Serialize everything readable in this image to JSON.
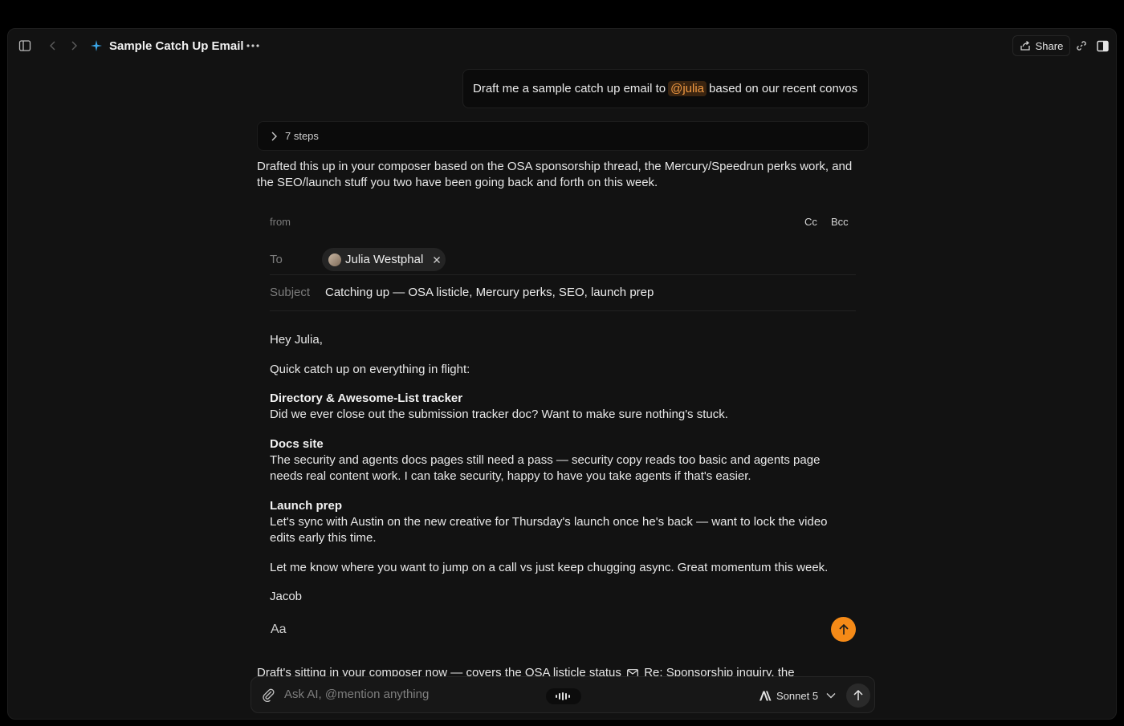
{
  "header": {
    "title": "Sample Catch Up Email",
    "share_label": "Share"
  },
  "conversation": {
    "user_message": {
      "before": "Draft me a sample catch up email to",
      "mention": "@julia",
      "after": "based on our recent convos"
    },
    "steps_label": "7 steps",
    "intro": "Drafted this up in your composer based on the OSA sponsorship thread, the Mercury/Speedrun perks work, and the SEO/launch stuff you two have been going back and forth on this week.",
    "draft_note": {
      "before": "Draft's sitting in your composer now — covers the OSA listicle status",
      "link": "Re: Sponsorship inquiry, the"
    }
  },
  "email": {
    "from_label": "from",
    "cc_label": "Cc",
    "bcc_label": "Bcc",
    "to_label": "To",
    "recipient": "Julia Westphal",
    "subject_label": "Subject",
    "subject": "Catching up — OSA listicle, Mercury perks, SEO, launch prep",
    "greeting": "Hey Julia,",
    "opening": "Quick catch up on everything in flight:",
    "sections": [
      {
        "heading": "Directory & Awesome-List tracker",
        "text": "Did we ever close out the submission tracker doc? Want to make sure nothing's stuck."
      },
      {
        "heading": "Docs site",
        "text": "The security and agents docs pages still need a pass — security copy reads too basic and agents page needs real content work. I can take security, happy to have you take agents if that's easier."
      },
      {
        "heading": "Launch prep",
        "text": "Let's sync with Austin on the new creative for Thursday's launch once he's back — want to lock the video edits early this time."
      }
    ],
    "closing": "Let me know where you want to jump on a call vs just keep chugging async. Great momentum this week.",
    "signature": "Jacob",
    "format_label": "Aa"
  },
  "chat_input": {
    "placeholder": "Ask AI, @mention anything",
    "model": "Sonnet 5"
  },
  "colors": {
    "accent": "#f58a17",
    "mention_text": "#f29a42",
    "sparkle": "#3ba6e8"
  }
}
